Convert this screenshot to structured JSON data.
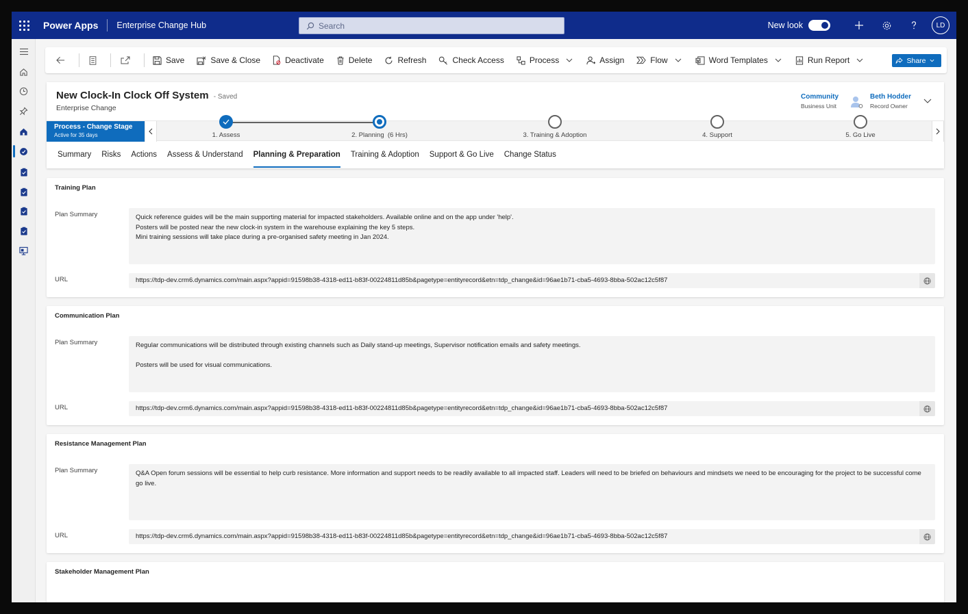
{
  "topbar": {
    "app_name": "Power Apps",
    "environment": "Enterprise Change Hub",
    "search_placeholder": "Search",
    "new_look_label": "New look",
    "avatar_initials": "LD"
  },
  "commands": {
    "save": "Save",
    "save_close": "Save & Close",
    "deactivate": "Deactivate",
    "delete": "Delete",
    "refresh": "Refresh",
    "check_access": "Check Access",
    "process": "Process",
    "assign": "Assign",
    "flow": "Flow",
    "word_templates": "Word Templates",
    "run_report": "Run Report",
    "share": "Share"
  },
  "record": {
    "title": "New Clock-In Clock Off System",
    "saved_status": "- Saved",
    "entity": "Enterprise Change",
    "business_unit_value": "Community",
    "business_unit_label": "Business Unit",
    "owner_value": "Beth Hodder",
    "owner_label": "Record Owner"
  },
  "bpf": {
    "stage_name": "Process - Change Stage",
    "stage_active": "Active for 35 days",
    "stages": [
      "1. Assess",
      "2. Planning",
      "3. Training & Adoption",
      "4. Support",
      "5. Go Live"
    ],
    "planning_duration": "(6 Hrs)"
  },
  "tabs": [
    "Summary",
    "Risks",
    "Actions",
    "Assess & Understand",
    "Planning & Preparation",
    "Training & Adoption",
    "Support & Go Live",
    "Change Status"
  ],
  "active_tab": "Planning & Preparation",
  "labels": {
    "plan_summary": "Plan Summary",
    "url": "URL"
  },
  "sections": [
    {
      "title": "Training Plan",
      "summary_lines": [
        "Quick reference guides will be the main supporting material for impacted stakeholders. Available online and on the app under 'help'.",
        "Posters will be posted near the new clock-in system in the warehouse explaining the key 5 steps.",
        "Mini training sessions will take place during a pre-organised safety meeting in Jan 2024."
      ],
      "url": "https://tdp-dev.crm6.dynamics.com/main.aspx?appid=91598b38-4318-ed11-b83f-00224811d85b&pagetype=entityrecord&etn=tdp_change&id=96ae1b71-cba5-4693-8bba-502ac12c5f87"
    },
    {
      "title": "Communication Plan",
      "summary_lines": [
        "Regular communications will be distributed through existing channels such as Daily stand-up meetings, Supervisor notification emails and safety meetings.",
        "",
        "Posters will be used for visual communications."
      ],
      "url": "https://tdp-dev.crm6.dynamics.com/main.aspx?appid=91598b38-4318-ed11-b83f-00224811d85b&pagetype=entityrecord&etn=tdp_change&id=96ae1b71-cba5-4693-8bba-502ac12c5f87"
    },
    {
      "title": "Resistance Management Plan",
      "summary_lines": [
        "Q&A Open forum sessions will be essential to help curb resistance. More information and support needs to be readily available to all impacted staff. Leaders will need to be briefed on behaviours and mindsets we need to be encouraging for the project to be successful come go live."
      ],
      "url": "https://tdp-dev.crm6.dynamics.com/main.aspx?appid=91598b38-4318-ed11-b83f-00224811d85b&pagetype=entityrecord&etn=tdp_change&id=96ae1b71-cba5-4693-8bba-502ac12c5f87"
    },
    {
      "title": "Stakeholder Management Plan"
    }
  ],
  "colors": {
    "topbar": "#0f2c8b",
    "accent": "#0f6cbd"
  },
  "icons": [
    "waffle-icon",
    "search-icon",
    "plus-icon",
    "gear-icon",
    "help-icon",
    "back-icon",
    "form-icon",
    "popout-icon",
    "save-icon",
    "save-close-icon",
    "deactivate-icon",
    "delete-icon",
    "refresh-icon",
    "check-access-icon",
    "process-icon",
    "assign-icon",
    "flow-icon",
    "word-templates-icon",
    "run-report-icon",
    "share-icon",
    "globe-icon"
  ]
}
